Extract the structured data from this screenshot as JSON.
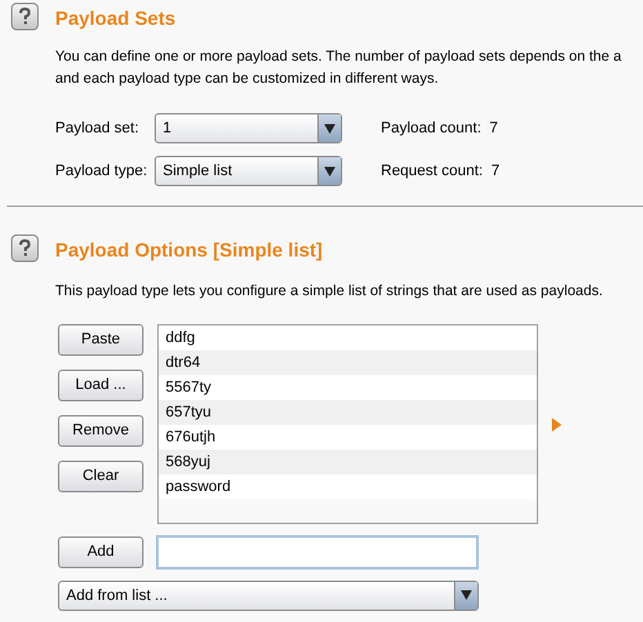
{
  "payload_sets": {
    "title": "Payload Sets",
    "description": [
      "You can define one or more payload sets. The number of payload sets depends on the a",
      "and each payload type can be customized in different ways."
    ],
    "fields": [
      {
        "label": "Payload set:",
        "value": "1",
        "count_label": "Payload count:",
        "count": "7"
      },
      {
        "label": "Payload type:",
        "value": "Simple list",
        "count_label": "Request count:",
        "count": "7"
      }
    ]
  },
  "payload_options": {
    "title": "Payload Options [Simple list]",
    "description": "This payload type lets you configure a simple list of strings that are used as payloads.",
    "buttons": [
      "Paste",
      "Load ...",
      "Remove",
      "Clear"
    ],
    "items": [
      "ddfg",
      "dtr64",
      "5567ty",
      "657tyu",
      "676utjh",
      "568yuj",
      "password"
    ],
    "add_button": "Add",
    "add_from_list": "Add from list ..."
  }
}
